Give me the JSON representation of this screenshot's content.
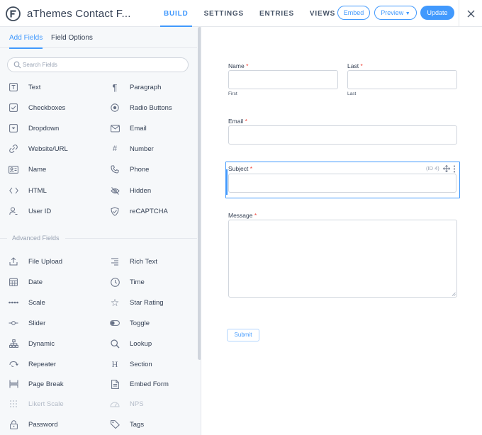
{
  "app": {
    "title": "aThemes Contact F..."
  },
  "nav": {
    "tabs": [
      {
        "label": "BUILD",
        "active": true
      },
      {
        "label": "SETTINGS"
      },
      {
        "label": "ENTRIES"
      },
      {
        "label": "VIEWS"
      }
    ],
    "embed_label": "Embed",
    "preview_label": "Preview",
    "update_label": "Update"
  },
  "sidebar": {
    "tabs": [
      {
        "label": "Add Fields",
        "active": true
      },
      {
        "label": "Field Options"
      }
    ],
    "search_placeholder": "Search Fields",
    "fields": [
      {
        "label": "Text",
        "icon": "text-field-icon"
      },
      {
        "label": "Paragraph",
        "icon": "paragraph-icon"
      },
      {
        "label": "Checkboxes",
        "icon": "checkbox-icon"
      },
      {
        "label": "Radio Buttons",
        "icon": "radio-button-icon"
      },
      {
        "label": "Dropdown",
        "icon": "dropdown-icon"
      },
      {
        "label": "Email",
        "icon": "envelope-icon"
      },
      {
        "label": "Website/URL",
        "icon": "link-icon"
      },
      {
        "label": "Number",
        "icon": "hash-icon"
      },
      {
        "label": "Name",
        "icon": "id-card-icon"
      },
      {
        "label": "Phone",
        "icon": "phone-icon"
      },
      {
        "label": "HTML",
        "icon": "code-icon"
      },
      {
        "label": "Hidden",
        "icon": "eye-slash-icon"
      },
      {
        "label": "User ID",
        "icon": "user-icon"
      },
      {
        "label": "reCAPTCHA",
        "icon": "shield-check-icon"
      }
    ],
    "advanced_heading": "Advanced Fields",
    "advanced_fields": [
      {
        "label": "File Upload",
        "icon": "upload-icon"
      },
      {
        "label": "Rich Text",
        "icon": "align-right-icon"
      },
      {
        "label": "Date",
        "icon": "calendar-icon"
      },
      {
        "label": "Time",
        "icon": "clock-icon"
      },
      {
        "label": "Scale",
        "icon": "dots-scale-icon"
      },
      {
        "label": "Star Rating",
        "icon": "star-icon"
      },
      {
        "label": "Slider",
        "icon": "slider-icon"
      },
      {
        "label": "Toggle",
        "icon": "toggle-icon"
      },
      {
        "label": "Dynamic",
        "icon": "sitemap-icon"
      },
      {
        "label": "Lookup",
        "icon": "magnifier-icon"
      },
      {
        "label": "Repeater",
        "icon": "repeat-icon"
      },
      {
        "label": "Section",
        "icon": "heading-icon"
      },
      {
        "label": "Page Break",
        "icon": "page-break-icon"
      },
      {
        "label": "Embed Form",
        "icon": "file-icon"
      },
      {
        "label": "Likert Scale",
        "icon": "grid-icon",
        "disabled": true
      },
      {
        "label": "NPS",
        "icon": "gauge-icon",
        "disabled": true
      },
      {
        "label": "Password",
        "icon": "lock-icon"
      },
      {
        "label": "Tags",
        "icon": "tag-icon"
      }
    ]
  },
  "form": {
    "first_name_label": "Name",
    "first_sub": "First",
    "last_name_label": "Last",
    "last_sub": "Last",
    "email_label": "Email",
    "subject_label": "Subject",
    "subject_id": "(ID 4)",
    "message_label": "Message",
    "required_mark": "*",
    "submit_label": "Submit"
  },
  "colors": {
    "accent": "#4199fd",
    "required": "#f04438",
    "sidebar_bg": "#f6f8fa"
  }
}
